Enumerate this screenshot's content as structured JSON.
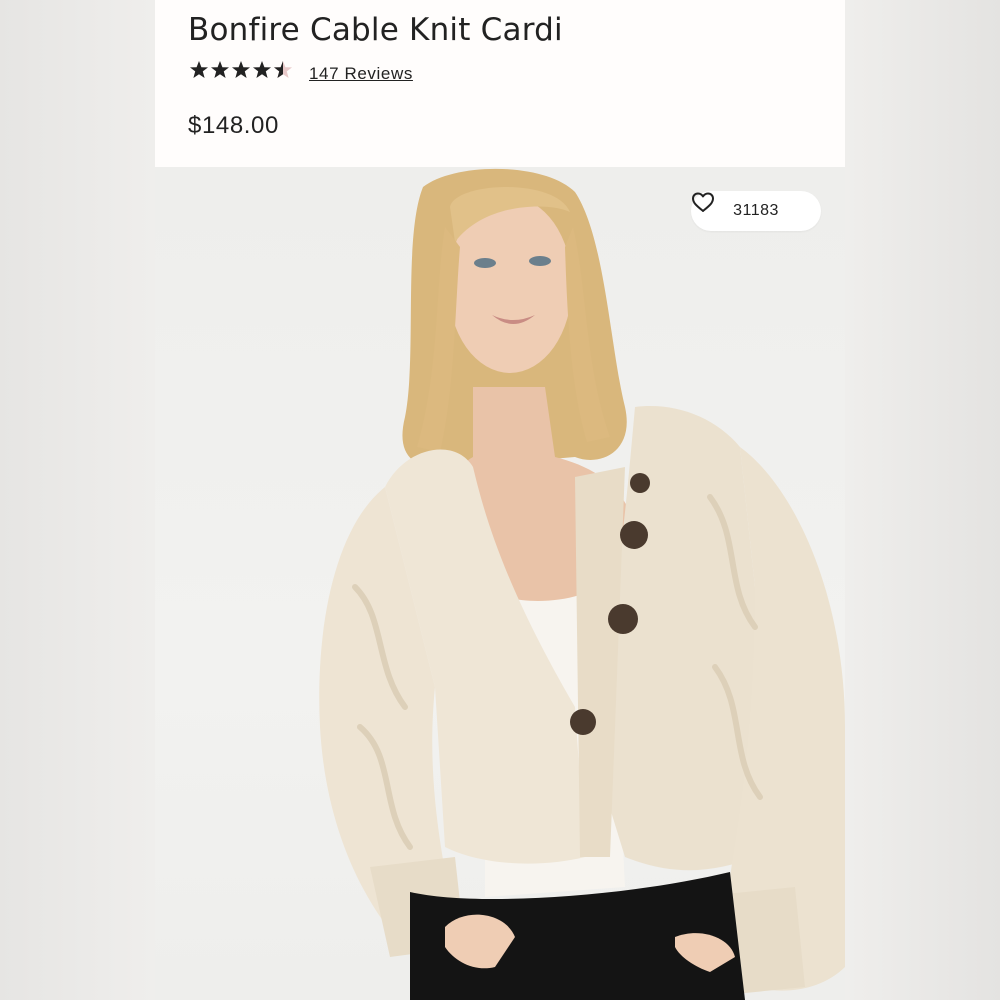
{
  "product": {
    "title": "Bonfire Cable Knit Cardi",
    "rating": 4.5,
    "reviews_label": "147 Reviews",
    "price": "$148.00",
    "favorites_count": "31183"
  },
  "icons": {
    "rating_star": "star-icon",
    "favorite": "heart-outline-icon"
  },
  "colors": {
    "star_fill": "#222222",
    "star_empty": "#e8c9c9",
    "cardigan": "#efe6d6",
    "background": "#ecebe9"
  }
}
